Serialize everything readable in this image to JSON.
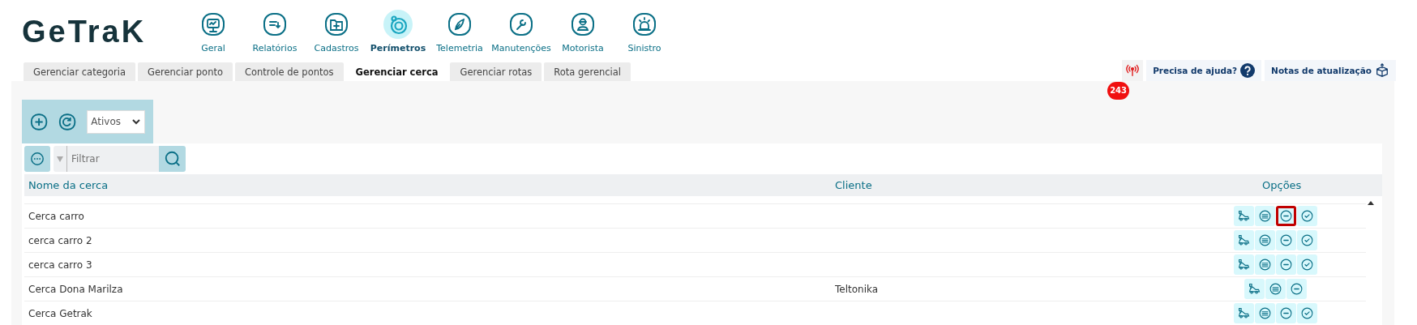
{
  "logo": "GeTraK",
  "nav": [
    {
      "label": "Geral",
      "kind": "monitor",
      "selected": false
    },
    {
      "label": "Relatórios",
      "kind": "report",
      "selected": false
    },
    {
      "label": "Cadastros",
      "kind": "folder",
      "selected": false
    },
    {
      "label": "Perímetros",
      "kind": "target",
      "selected": true
    },
    {
      "label": "Telemetria",
      "kind": "compass",
      "selected": false
    },
    {
      "label": "Manutenções",
      "kind": "wrench",
      "selected": false
    },
    {
      "label": "Motorista",
      "kind": "driver",
      "selected": false
    },
    {
      "label": "Sinistro",
      "kind": "alarm",
      "selected": false
    }
  ],
  "tabs": [
    {
      "label": "Gerenciar categoria",
      "selected": false
    },
    {
      "label": "Gerenciar ponto",
      "selected": false
    },
    {
      "label": "Controle de pontos",
      "selected": false
    },
    {
      "label": "Gerenciar cerca",
      "selected": true
    },
    {
      "label": "Gerenciar rotas",
      "selected": false
    },
    {
      "label": "Rota gerencial",
      "selected": false
    }
  ],
  "alerts": {
    "count": "243"
  },
  "help": {
    "label": "Precisa de ajuda?"
  },
  "notes": {
    "label": "Notas de atualização"
  },
  "status_select": {
    "value": "Ativos"
  },
  "filter": {
    "placeholder": "Filtrar"
  },
  "table": {
    "columns": [
      "Nome da cerca",
      "Cliente",
      "Opções"
    ],
    "rows": [
      {
        "name": "Cerca carro",
        "actions": [
          {
            "kind": "route",
            "highlighted": false
          },
          {
            "kind": "list",
            "highlighted": false
          },
          {
            "kind": "remove",
            "highlighted": true
          },
          {
            "kind": "activate",
            "highlighted": false
          }
        ]
      },
      {
        "name": "cerca carro 2",
        "actions": [
          {
            "kind": "route",
            "highlighted": false
          },
          {
            "kind": "list",
            "highlighted": false
          },
          {
            "kind": "remove",
            "highlighted": false
          },
          {
            "kind": "activate",
            "highlighted": false
          }
        ]
      },
      {
        "name": "cerca carro 3",
        "actions": [
          {
            "kind": "route",
            "highlighted": false
          },
          {
            "kind": "list",
            "highlighted": false
          },
          {
            "kind": "remove",
            "highlighted": false
          },
          {
            "kind": "activate",
            "highlighted": false
          }
        ]
      },
      {
        "name": "Cerca Dona Marilza",
        "client": "Teltonika",
        "actions": [
          {
            "kind": "route",
            "highlighted": false
          },
          {
            "kind": "list",
            "highlighted": false
          },
          {
            "kind": "remove",
            "highlighted": false
          }
        ]
      },
      {
        "name": "Cerca Getrak",
        "actions": [
          {
            "kind": "route",
            "highlighted": false
          },
          {
            "kind": "list",
            "highlighted": false
          },
          {
            "kind": "remove",
            "highlighted": false
          },
          {
            "kind": "activate",
            "highlighted": false
          }
        ]
      }
    ]
  }
}
